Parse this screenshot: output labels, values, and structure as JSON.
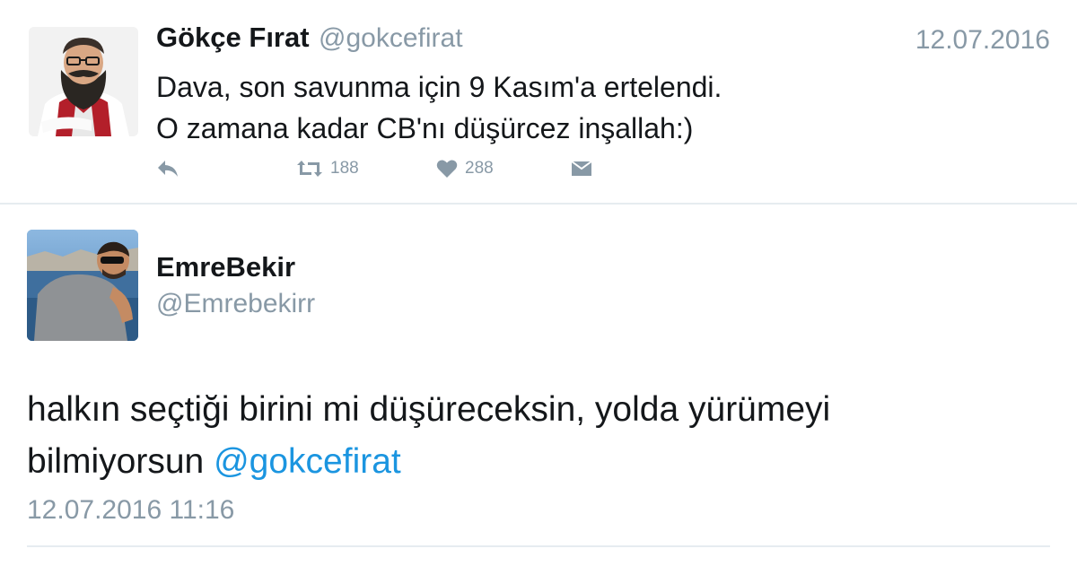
{
  "parent_tweet": {
    "author_name": "Gökçe Fırat",
    "author_handle": "@gokcefirat",
    "date": "12.07.2016",
    "text_lines": [
      "Dava, son savunma için 9 Kasım'a ertelendi.",
      "O zamana kadar CB'nı düşürcez inşallah:)"
    ],
    "actions": {
      "reply_icon": "reply-icon",
      "retweet_icon": "retweet-icon",
      "retweet_count": "188",
      "like_icon": "heart-icon",
      "like_count": "288",
      "dm_icon": "envelope-icon"
    }
  },
  "main_tweet": {
    "author_name": "EmreBekir",
    "author_handle": "@Emrebekirr",
    "text_line1": "halkın seçtiği birini mi düşüreceksin, yolda yürümeyi",
    "text_line2_prefix": "bilmiyorsun ",
    "mention": "@gokcefirat",
    "timestamp": "12.07.2016 11:16"
  },
  "colors": {
    "text": "#14171a",
    "muted": "#8899a6",
    "link": "#1b95e0",
    "divider": "#e6ecf0"
  }
}
